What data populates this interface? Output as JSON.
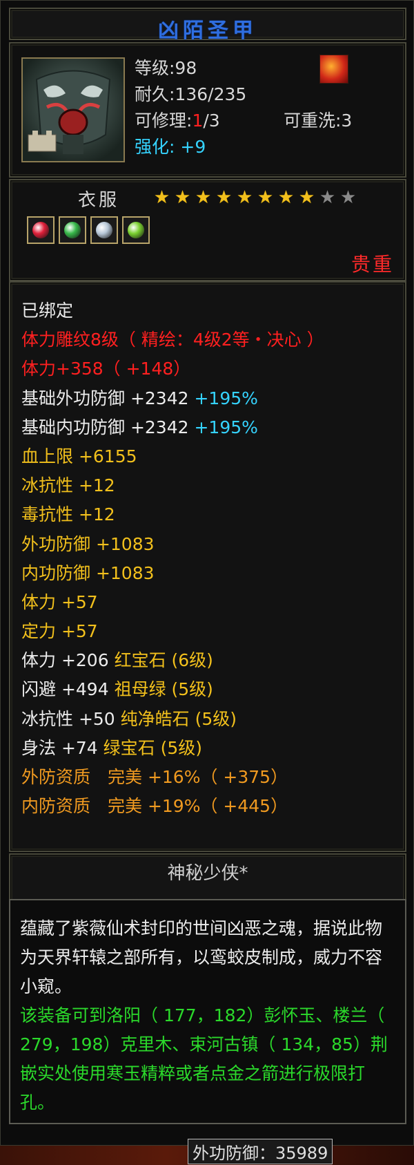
{
  "item": {
    "name": "凶陌圣甲",
    "level": "等级:98",
    "durability": "耐久:136/235",
    "repair_label": "可修理:",
    "repair_used": "1",
    "repair_total": "/3",
    "rewash": "可重洗:3",
    "enhance": "强化: +9",
    "category": "衣服",
    "stars_total": 10,
    "stars_filled": 7.5,
    "rarity_tag": "贵重",
    "owner": "神秘少侠*",
    "badge_icon": "phoenix-flame-icon"
  },
  "gems": [
    {
      "icon": "ruby-gem-icon",
      "color": "#e0203a"
    },
    {
      "icon": "emerald-gem-icon",
      "color": "#38b84a"
    },
    {
      "icon": "pure-stone-gem-icon",
      "color": "#b8c8d8"
    },
    {
      "icon": "green-sapphire-gem-icon",
      "color": "#7ad030"
    }
  ],
  "attributes": [
    {
      "text": "已绑定",
      "color": "white"
    },
    {
      "text": "体力雕纹8级（ 精绘：4级2等・决心 ）",
      "color": "red"
    },
    {
      "text": "体力+358（ +148）",
      "color": "red"
    },
    {
      "text": "基础外功防御 +2342",
      "extra": " +195%",
      "color": "white",
      "extra_color": "cyan"
    },
    {
      "text": "基础内功防御 +2342",
      "extra": " +195%",
      "color": "white",
      "extra_color": "cyan"
    },
    {
      "text": "血上限 +6155",
      "color": "yellow"
    },
    {
      "text": "冰抗性 +12",
      "color": "yellow"
    },
    {
      "text": "毒抗性 +12",
      "color": "yellow"
    },
    {
      "text": "外功防御 +1083",
      "color": "yellow"
    },
    {
      "text": "内功防御 +1083",
      "color": "yellow"
    },
    {
      "text": "体力 +57",
      "color": "yellow"
    },
    {
      "text": "定力 +57",
      "color": "yellow"
    },
    {
      "text": "体力 +206",
      "extra": " 红宝石 (6级)",
      "color": "white",
      "extra_color": "yellow"
    },
    {
      "text": "闪避 +494",
      "extra": " 祖母绿 (5级)",
      "color": "white",
      "extra_color": "yellow"
    },
    {
      "text": "冰抗性 +50",
      "extra": " 纯净皓石 (5级)",
      "color": "white",
      "extra_color": "yellow"
    },
    {
      "text": "身法 +74",
      "extra": " 绿宝石 (5级)",
      "color": "white",
      "extra_color": "yellow"
    },
    {
      "text": "外防资质　完美 +16%（ +375）",
      "color": "orange"
    },
    {
      "text": "内防资质　完美 +19%（ +445）",
      "color": "orange"
    }
  ],
  "description": {
    "lore": "蕴藏了紫薇仙术封印的世间凶恶之魂，据说此物为天界轩辕之部所有，以鸾蛟皮制成，威力不容小窥。",
    "hint": "该装备可到洛阳（ 177，182）彭怀玉、楼兰（ 279，198）克里木、束河古镇（ 134，85）荆嵌实处使用寒玉精粹或者点金之箭进行极限打孔。"
  },
  "bottom_text": "外功防御：35989"
}
